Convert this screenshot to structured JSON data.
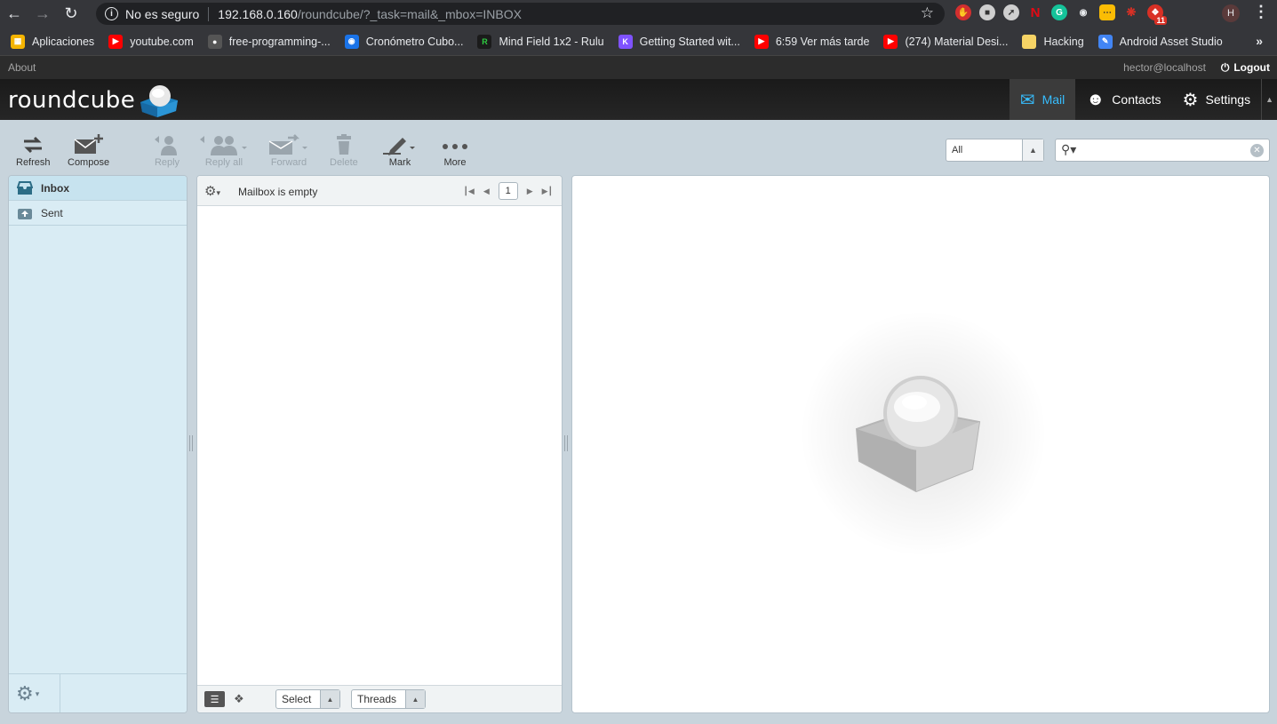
{
  "browser": {
    "security_label": "No es seguro",
    "url_host": "192.168.0.160",
    "url_path": "/roundcube/?_task=mail&_mbox=INBOX",
    "profile_initial": "H",
    "extension_badge": "11"
  },
  "bookmarks": [
    {
      "label": "Aplicaciones",
      "icon": "apps-grid-icon",
      "color": "#f4b400"
    },
    {
      "label": "youtube.com",
      "icon": "youtube-icon",
      "color": "#ff0000"
    },
    {
      "label": "free-programming-...",
      "icon": "github-icon",
      "color": "#555555"
    },
    {
      "label": "Cronómetro Cubo...",
      "icon": "globe-icon",
      "color": "#1a73e8"
    },
    {
      "label": "Mind Field 1x2 - Rulu",
      "icon": "r-icon",
      "color": "#1b1b1b"
    },
    {
      "label": "Getting Started wit...",
      "icon": "kotlin-icon",
      "color": "#7f52ff"
    },
    {
      "label": "6:59 Ver más tarde",
      "icon": "youtube-icon",
      "color": "#ff0000"
    },
    {
      "label": "(274) Material Desi...",
      "icon": "youtube-icon",
      "color": "#ff0000"
    },
    {
      "label": "Hacking",
      "icon": "folder-icon",
      "color": "#f6d365"
    },
    {
      "label": "Android Asset Studio",
      "icon": "android-studio-icon",
      "color": "#4285f4"
    }
  ],
  "topline": {
    "about": "About",
    "user": "hector@localhost",
    "logout": "Logout"
  },
  "app": {
    "logo_text": "roundcube"
  },
  "topnav": [
    {
      "label": "Mail",
      "active": true
    },
    {
      "label": "Contacts",
      "active": false
    },
    {
      "label": "Settings",
      "active": false
    }
  ],
  "toolbar": {
    "refresh": "Refresh",
    "compose": "Compose",
    "reply": "Reply",
    "reply_all": "Reply all",
    "forward": "Forward",
    "delete": "Delete",
    "mark": "Mark",
    "more": "More"
  },
  "filter": {
    "selected": "All"
  },
  "folders": [
    {
      "label": "Inbox",
      "active": true
    },
    {
      "label": "Sent",
      "active": false
    }
  ],
  "message_list": {
    "status": "Mailbox is empty",
    "page": "1",
    "select_label": "Select",
    "threads_label": "Threads"
  },
  "colors": {
    "accent": "#37beff",
    "header_bg": "#1f1f1f",
    "page_bg": "#c8d4dc",
    "folder_bg": "#d9ecf4"
  }
}
